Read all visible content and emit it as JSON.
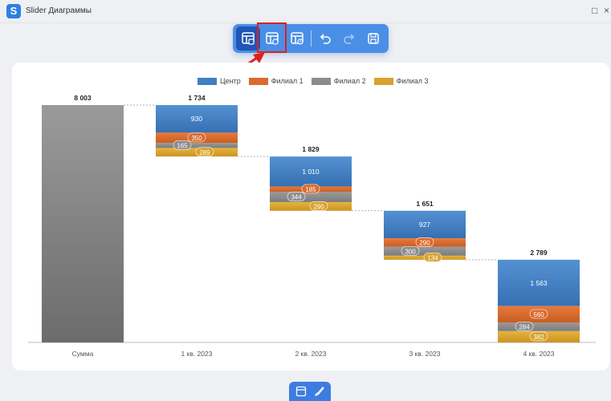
{
  "window": {
    "title": "Slider Диаграммы",
    "app_icon_letter": "S"
  },
  "toolbar": {
    "icons": [
      "chart-edit-icon",
      "chart-settings-icon",
      "chart-add-icon",
      "undo-icon",
      "redo-icon",
      "save-icon"
    ],
    "active_index": 0,
    "highlighted_index": 1
  },
  "bottom_toolbar": {
    "icons": [
      "layout-icon",
      "brush-icon"
    ]
  },
  "colors": {
    "center": "#3f7fc4",
    "branch1": "#db6a2c",
    "branch2": "#8c8c8c",
    "branch3": "#d9a22e",
    "total": "#8a8a8a",
    "accent": "#4a8fe6",
    "highlight": "#e01f1f"
  },
  "chart_data": {
    "type": "bar",
    "subtype": "waterfall",
    "categories": [
      "Сумма",
      "1 кв. 2023",
      "2 кв. 2023",
      "3 кв. 2023",
      "4 кв. 2023"
    ],
    "total": {
      "category": "Сумма",
      "value": 8003,
      "label": "8 003"
    },
    "series": [
      {
        "name": "Центр",
        "values": [
          930,
          1010,
          927,
          1563
        ],
        "labels": [
          "930",
          "1 010",
          "927",
          "1 563"
        ]
      },
      {
        "name": "Филиал 1",
        "values": [
          350,
          185,
          290,
          560
        ],
        "labels": [
          "350",
          "185",
          "290",
          "560"
        ]
      },
      {
        "name": "Филиал 2",
        "values": [
          165,
          344,
          300,
          284
        ],
        "labels": [
          "165",
          "344",
          "300",
          "284"
        ]
      },
      {
        "name": "Филиал 3",
        "values": [
          289,
          290,
          134,
          382
        ],
        "labels": [
          "289",
          "290",
          "134",
          "382"
        ]
      }
    ],
    "quarter_totals": [
      1734,
      1829,
      1651,
      2789
    ],
    "quarter_total_labels": [
      "1 734",
      "1 829",
      "1 651",
      "2 789"
    ],
    "ylim": [
      0,
      8003
    ],
    "legend_position": "top-center",
    "grid": false
  }
}
